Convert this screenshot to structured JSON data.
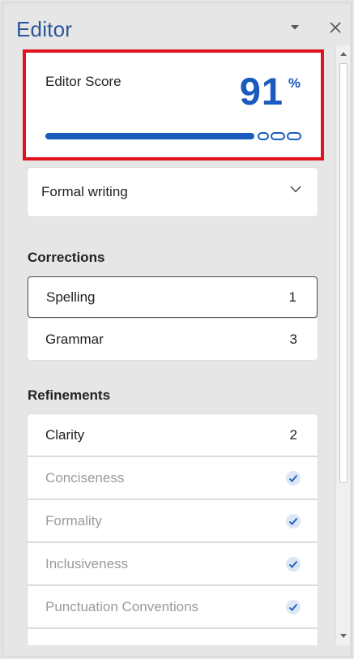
{
  "pane": {
    "title": "Editor",
    "options_icon": "chevron-down-icon",
    "close_icon": "close-icon"
  },
  "score": {
    "label": "Editor Score",
    "value": "91",
    "unit": "%",
    "progress_fraction": 0.91,
    "accent_color": "#1a5bbf",
    "highlight_color": "#e3111b"
  },
  "writing_style": {
    "selected": "Formal writing",
    "icon": "chevron-down-icon"
  },
  "corrections": {
    "heading": "Corrections",
    "items": [
      {
        "label": "Spelling",
        "count": "1"
      },
      {
        "label": "Grammar",
        "count": "3"
      }
    ]
  },
  "refinements": {
    "heading": "Refinements",
    "items": [
      {
        "label": "Clarity",
        "count": "2"
      },
      {
        "label": "Conciseness",
        "status_icon": "check-icon"
      },
      {
        "label": "Formality",
        "status_icon": "check-icon"
      },
      {
        "label": "Inclusiveness",
        "status_icon": "check-icon"
      },
      {
        "label": "Punctuation Conventions",
        "status_icon": "check-icon"
      }
    ]
  },
  "check_color": "#1a5bbf"
}
